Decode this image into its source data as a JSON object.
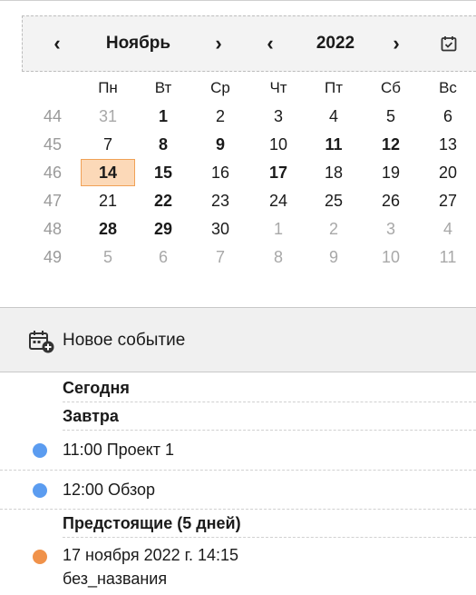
{
  "calendar": {
    "month_label": "Ноябрь",
    "year_label": "2022",
    "prev_month_glyph": "‹",
    "next_month_glyph": "›",
    "prev_year_glyph": "‹",
    "next_year_glyph": "›",
    "day_names": [
      "Пн",
      "Вт",
      "Ср",
      "Чт",
      "Пт",
      "Сб",
      "Вс"
    ],
    "weeks": [
      {
        "num": "44",
        "days": [
          {
            "d": "31",
            "other": true
          },
          {
            "d": "1",
            "bold": true
          },
          {
            "d": "2"
          },
          {
            "d": "3"
          },
          {
            "d": "4"
          },
          {
            "d": "5"
          },
          {
            "d": "6"
          }
        ]
      },
      {
        "num": "45",
        "days": [
          {
            "d": "7"
          },
          {
            "d": "8",
            "bold": true
          },
          {
            "d": "9",
            "bold": true
          },
          {
            "d": "10"
          },
          {
            "d": "11",
            "bold": true
          },
          {
            "d": "12",
            "bold": true
          },
          {
            "d": "13"
          }
        ]
      },
      {
        "num": "46",
        "days": [
          {
            "d": "14",
            "bold": true,
            "today": true
          },
          {
            "d": "15",
            "bold": true
          },
          {
            "d": "16"
          },
          {
            "d": "17",
            "bold": true
          },
          {
            "d": "18"
          },
          {
            "d": "19"
          },
          {
            "d": "20"
          }
        ]
      },
      {
        "num": "47",
        "days": [
          {
            "d": "21"
          },
          {
            "d": "22",
            "bold": true
          },
          {
            "d": "23"
          },
          {
            "d": "24"
          },
          {
            "d": "25"
          },
          {
            "d": "26"
          },
          {
            "d": "27"
          }
        ]
      },
      {
        "num": "48",
        "days": [
          {
            "d": "28",
            "bold": true
          },
          {
            "d": "29",
            "bold": true
          },
          {
            "d": "30"
          },
          {
            "d": "1",
            "other": true
          },
          {
            "d": "2",
            "other": true
          },
          {
            "d": "3",
            "other": true
          },
          {
            "d": "4",
            "other": true
          }
        ]
      },
      {
        "num": "49",
        "days": [
          {
            "d": "5",
            "other": true
          },
          {
            "d": "6",
            "other": true
          },
          {
            "d": "7",
            "other": true
          },
          {
            "d": "8",
            "other": true
          },
          {
            "d": "9",
            "other": true
          },
          {
            "d": "10",
            "other": true
          },
          {
            "d": "11",
            "other": true
          }
        ]
      }
    ]
  },
  "toolbar": {
    "new_event_label": "Новое событие"
  },
  "agenda": {
    "today_label": "Сегодня",
    "tomorrow_label": "Завтра",
    "tomorrow_events": [
      {
        "text": "11:00 Проект 1",
        "color": "#5b9cf0"
      },
      {
        "text": "12:00 Обзор",
        "color": "#5b9cf0"
      }
    ],
    "upcoming_label": "Предстоящие (5 дней)",
    "upcoming_events": [
      {
        "line1": "17 ноября 2022 г. 14:15",
        "line2": "без_названия",
        "color": "#f0924a"
      }
    ]
  },
  "colors": {
    "today_fill": "#fcd9b8",
    "today_border": "#f0a156",
    "event_blue": "#5b9cf0",
    "event_orange": "#f0924a"
  }
}
